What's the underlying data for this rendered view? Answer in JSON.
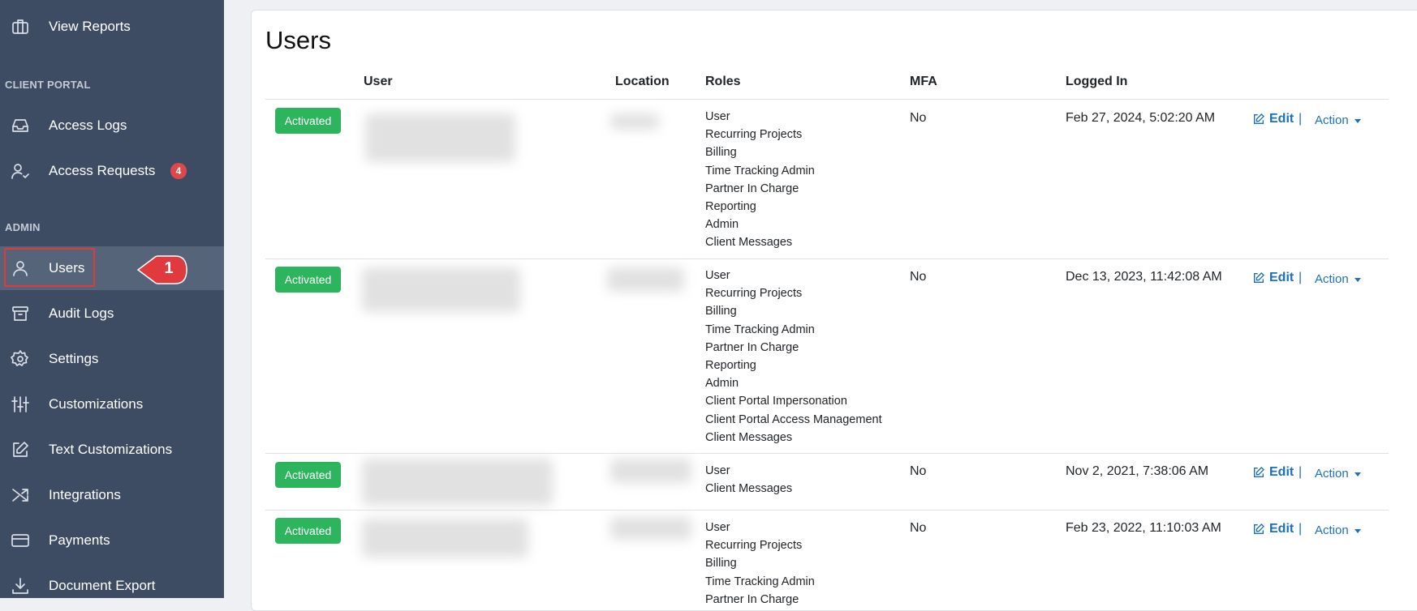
{
  "sidebar": {
    "sections": {
      "client_portal": "CLIENT PORTAL",
      "admin": "ADMIN"
    },
    "items": [
      {
        "label": "View Reports",
        "icon": "reports-icon"
      },
      {
        "label": "Access Logs",
        "icon": "inbox-icon"
      },
      {
        "label": "Access Requests",
        "icon": "user-check-icon",
        "badge": "4"
      },
      {
        "label": "Users",
        "icon": "user-icon",
        "active": true
      },
      {
        "label": "Audit Logs",
        "icon": "archive-icon"
      },
      {
        "label": "Settings",
        "icon": "gear-icon"
      },
      {
        "label": "Customizations",
        "icon": "sliders-icon"
      },
      {
        "label": "Text Customizations",
        "icon": "edit-icon"
      },
      {
        "label": "Integrations",
        "icon": "shuffle-icon"
      },
      {
        "label": "Payments",
        "icon": "credit-card-icon"
      },
      {
        "label": "Document Export",
        "icon": "download-icon"
      }
    ],
    "annotation_number": "1"
  },
  "main": {
    "title": "Users",
    "columns": [
      "User",
      "Location",
      "Roles",
      "MFA",
      "Logged In"
    ],
    "rows": [
      {
        "status": "Activated",
        "roles": [
          "User",
          "Recurring Projects",
          "Billing",
          "Time Tracking Admin",
          "Partner In Charge",
          "Reporting",
          "Admin",
          "Client Messages"
        ],
        "mfa": "No",
        "logged_in": "Feb 27, 2024, 5:02:20 AM",
        "edit": "Edit",
        "action": "Action"
      },
      {
        "status": "Activated",
        "roles": [
          "User",
          "Recurring Projects",
          "Billing",
          "Time Tracking Admin",
          "Partner In Charge",
          "Reporting",
          "Admin",
          "Client Portal Impersonation",
          "Client Portal Access Management",
          "Client Messages"
        ],
        "mfa": "No",
        "logged_in": "Dec 13, 2023, 11:42:08 AM",
        "edit": "Edit",
        "action": "Action"
      },
      {
        "status": "Activated",
        "roles": [
          "User",
          "Client Messages"
        ],
        "mfa": "No",
        "logged_in": "Nov 2, 2021, 7:38:06 AM",
        "edit": "Edit",
        "action": "Action"
      },
      {
        "status": "Activated",
        "roles": [
          "User",
          "Recurring Projects",
          "Billing",
          "Time Tracking Admin",
          "Partner In Charge"
        ],
        "mfa": "No",
        "logged_in": "Feb 23, 2022, 11:10:03 AM",
        "edit": "Edit",
        "action": "Action"
      }
    ]
  },
  "colors": {
    "sidebar_bg": "#3d4c63",
    "active_bg": "#56647a",
    "status_green": "#2db55d",
    "link_blue": "#1a6fc2",
    "badge_red": "#e0474c",
    "annotation_red": "#e03a3e"
  }
}
